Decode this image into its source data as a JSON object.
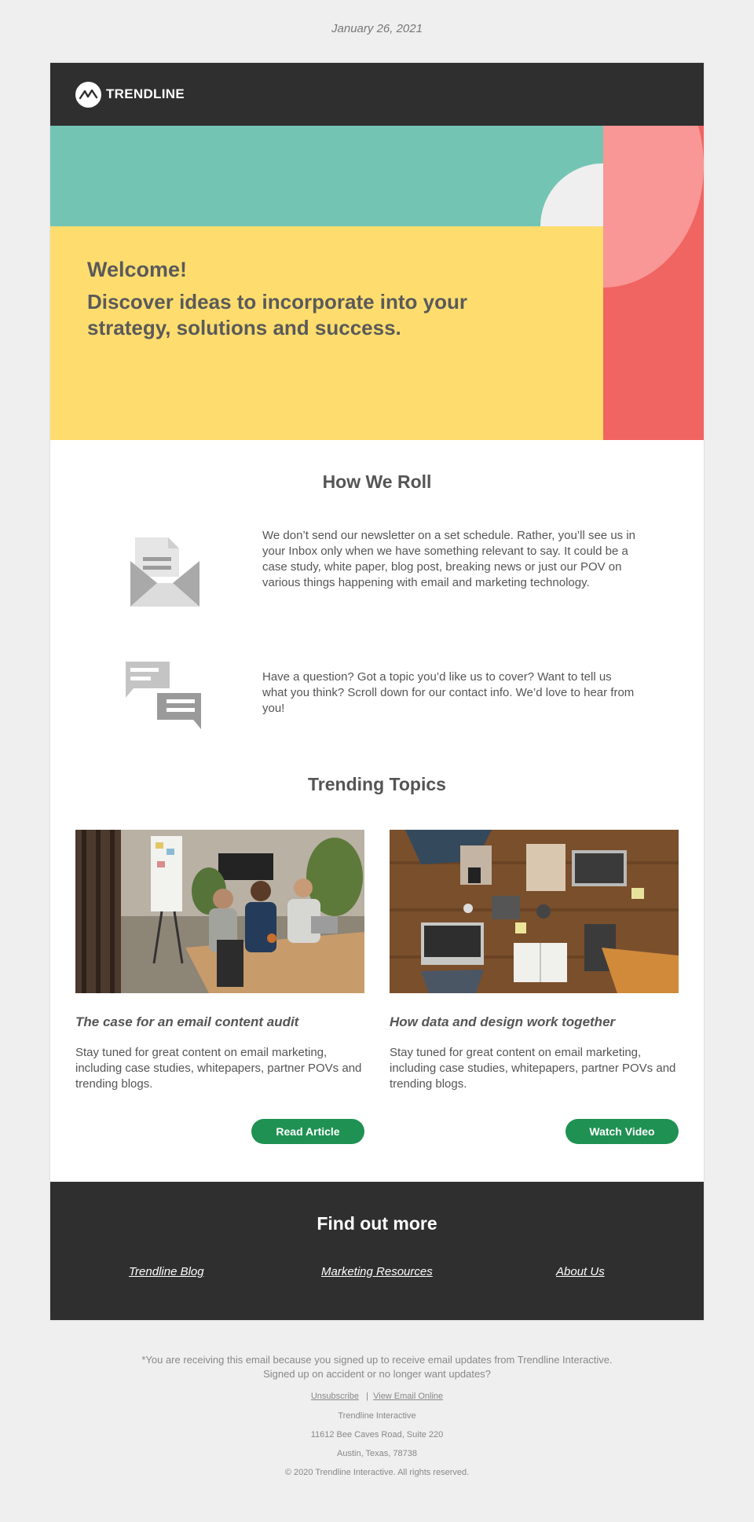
{
  "date": "January 26, 2021",
  "brand": {
    "name": "TRENDLINE"
  },
  "hero": {
    "welcome": "Welcome!",
    "headline": "Discover ideas to incorporate into your strategy, solutions and success.",
    "colors": {
      "teal": "#74c4b4",
      "yellow": "#fedd6e",
      "red": "#f06462",
      "pink": "#f89795"
    }
  },
  "how_we_roll": {
    "title": "How We Roll",
    "items": [
      {
        "icon": "envelope-icon",
        "text": "We don’t send our newsletter on a set schedule. Rather, you’ll see us in your Inbox only when we have something relevant to say. It could be a case study, white paper, blog post, breaking news or just our POV on various things happening with email and marketing technology."
      },
      {
        "icon": "chat-bubbles-icon",
        "text": "Have a question? Got a topic you’d like us to cover? Want to tell us what you think? Scroll down for our contact info. We’d love to hear from you!"
      }
    ]
  },
  "trending": {
    "title": "Trending Topics",
    "articles": [
      {
        "image": "meeting-photo",
        "title": "The case for an email content audit",
        "body": "Stay tuned for great content on email marketing, including case studies, whitepapers, partner POVs and trending blogs.",
        "cta": "Read Article"
      },
      {
        "image": "desk-photo",
        "title": "How data and design work together",
        "body": "Stay tuned for great content on email marketing, including case studies, whitepapers, partner POVs and trending blogs.",
        "cta": "Watch Video"
      }
    ]
  },
  "footer": {
    "title": "Find out more",
    "links": [
      "Trendline Blog",
      "Marketing Resources",
      "About Us"
    ]
  },
  "legal": {
    "notice_line1": "*You are receiving this email because you signed up to receive email updates from Trendline Interactive.",
    "notice_line2": "Signed up on accident or no longer want updates?",
    "unsubscribe": "Unsubscribe",
    "separator": "|",
    "view_online": "View Email Online",
    "company": "Trendline Interactive",
    "address1": "11612 Bee Caves Road, Suite 220",
    "address2": "Austin, Texas, 78738",
    "copyright": "© 2020 Trendline Interactive. All rights reserved."
  },
  "colors": {
    "button": "#1f9152",
    "dark_band": "#2f2f2f",
    "page_bg": "#efefef"
  }
}
